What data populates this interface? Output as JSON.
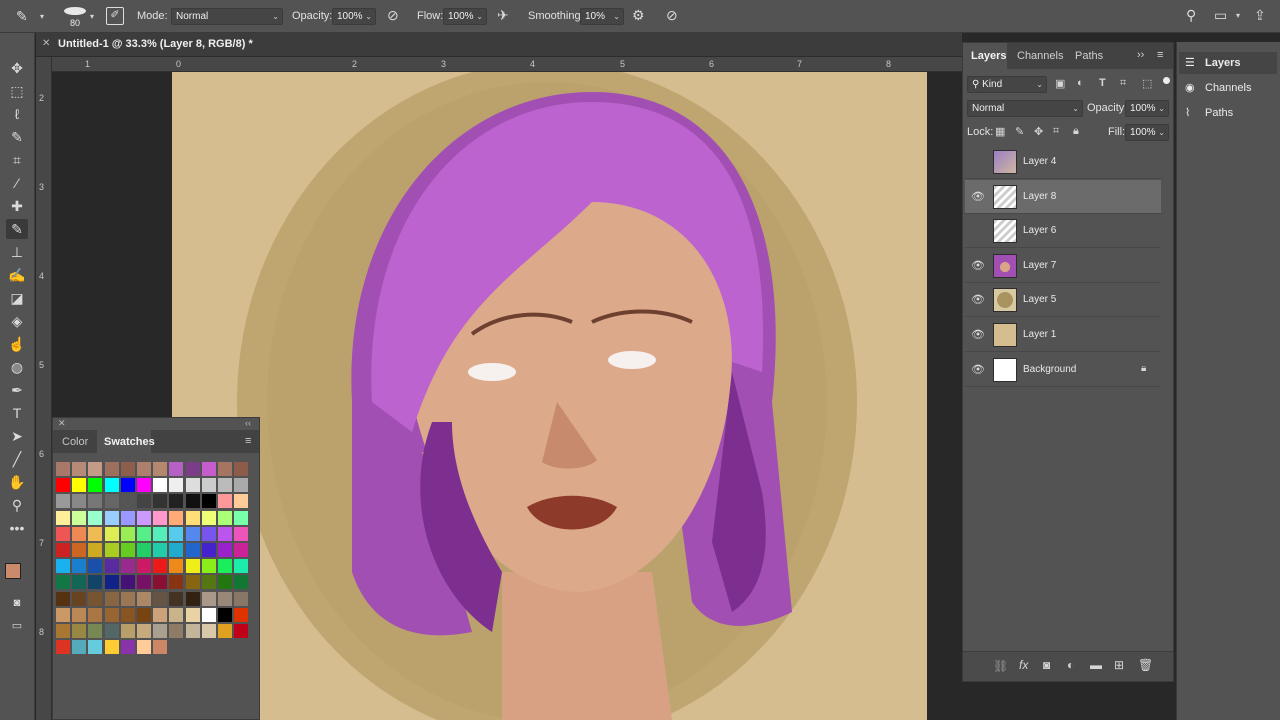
{
  "options_bar": {
    "brush_size": "80",
    "mode_label": "Mode:",
    "mode_value": "Normal",
    "opacity_label": "Opacity:",
    "opacity_value": "100%",
    "flow_label": "Flow:",
    "flow_value": "100%",
    "smoothing_label": "Smoothing:",
    "smoothing_value": "10%"
  },
  "document": {
    "tab_title": "Untitled-1 @ 33.3% (Layer 8, RGB/8) *"
  },
  "rulers": {
    "h": [
      "1",
      "0",
      "2",
      "3",
      "4",
      "5",
      "6",
      "7",
      "8"
    ],
    "v": [
      "2",
      "3",
      "4",
      "5",
      "6",
      "7",
      "8"
    ]
  },
  "swatches_panel": {
    "tab_color": "Color",
    "tab_swatches": "Swatches"
  },
  "layers_panel": {
    "tabs": [
      "Layers",
      "Channels",
      "Paths"
    ],
    "filter_value": "Kind",
    "blend_mode": "Normal",
    "opacity_label": "Opacity:",
    "opacity_value": "100%",
    "lock_label": "Lock:",
    "fill_label": "Fill:",
    "fill_value": "100%",
    "layers": [
      {
        "name": "Layer 4",
        "visible": false
      },
      {
        "name": "Layer 8",
        "visible": true,
        "selected": true
      },
      {
        "name": "Layer 6",
        "visible": false
      },
      {
        "name": "Layer 7",
        "visible": true
      },
      {
        "name": "Layer 5",
        "visible": true
      },
      {
        "name": "Layer 1",
        "visible": true
      },
      {
        "name": "Background",
        "visible": true,
        "locked": true
      }
    ]
  },
  "collapsed_panels": {
    "items": [
      "Layers",
      "Channels",
      "Paths"
    ]
  },
  "colors": {
    "foreground": "#c98b6b",
    "background": "#e8c04a",
    "hair": "#b65fc6",
    "canvas_bg": "#d5bd8f"
  }
}
